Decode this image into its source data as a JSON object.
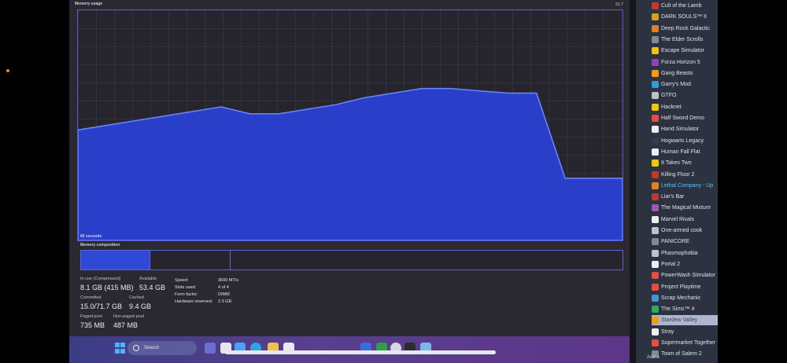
{
  "memory": {
    "title": "Memory usage",
    "max_label": "61.7",
    "seconds_label": "60 seconds",
    "composition_title": "Memory composition",
    "usage_curve": [
      0.48,
      0.5,
      0.52,
      0.54,
      0.56,
      0.58,
      0.55,
      0.55,
      0.57,
      0.59,
      0.62,
      0.64,
      0.66,
      0.66,
      0.65,
      0.64,
      0.64,
      0.27,
      0.27,
      0.27
    ],
    "stats": {
      "in_use_label": "In use (Compressed)",
      "in_use_value": "8.1 GB (415 MB)",
      "available_label": "Available",
      "available_value": "53.4 GB",
      "committed_label": "Committed",
      "committed_value": "15.0/71.7 GB",
      "cached_label": "Cached",
      "cached_value": "9.4 GB",
      "paged_label": "Paged pool",
      "paged_value": "735 MB",
      "nonpaged_label": "Non-paged pool",
      "nonpaged_value": "487 MB",
      "speed_label": "Speed:",
      "speed_value": "3600 MT/s",
      "slots_label": "Slots used:",
      "slots_value": "4 of 4",
      "form_label": "Form factor:",
      "form_value": "DIMM",
      "hw_label": "Hardware reserved:",
      "hw_value": "2.3 GB"
    }
  },
  "taskbar": {
    "search_placeholder": "Search"
  },
  "steam": {
    "games": [
      {
        "label": "Cult of the Lamb",
        "icon": "game-icon",
        "color": "#c0392b"
      },
      {
        "label": "DARK SOULS™ II",
        "icon": "game-icon",
        "color": "#d4a017"
      },
      {
        "label": "Deep Rock Galactic",
        "icon": "game-icon",
        "color": "#e67e22"
      },
      {
        "label": "The Elder Scrolls",
        "icon": "game-icon",
        "color": "#7f8c8d"
      },
      {
        "label": "Escape Simulator",
        "icon": "game-icon",
        "color": "#f1c40f"
      },
      {
        "label": "Forza Horizon 5",
        "icon": "game-icon",
        "color": "#8e44ad"
      },
      {
        "label": "Gang Beasts",
        "icon": "game-icon",
        "color": "#f39c12"
      },
      {
        "label": "Garry's Mod",
        "icon": "game-icon",
        "color": "#3498db"
      },
      {
        "label": "GTFO",
        "icon": "game-icon",
        "color": "#bdc3c7"
      },
      {
        "label": "Hacknet",
        "icon": "game-icon",
        "color": "#f1c40f"
      },
      {
        "label": "Half Sword Demo",
        "icon": "game-icon",
        "color": "#e74c3c"
      },
      {
        "label": "Hand Simulator",
        "icon": "game-icon",
        "color": "#ecf0f1"
      },
      {
        "label": "Hogwarts Legacy",
        "icon": "game-icon",
        "color": "#2c3e50"
      },
      {
        "label": "Human Fall Flat",
        "icon": "game-icon",
        "color": "#ecf0f1"
      },
      {
        "label": "It Takes Two",
        "icon": "game-icon",
        "color": "#f1c40f"
      },
      {
        "label": "Killing Floor 2",
        "icon": "game-icon",
        "color": "#c0392b"
      },
      {
        "label": "Lethal Company - Up",
        "icon": "game-icon",
        "color": "#e67e22"
      },
      {
        "label": "Liar's Bar",
        "icon": "game-icon",
        "color": "#c0392b"
      },
      {
        "label": "The Magical Mixture",
        "icon": "game-icon",
        "color": "#9b59b6"
      },
      {
        "label": "Marvel Rivals",
        "icon": "game-icon",
        "color": "#ecf0f1"
      },
      {
        "label": "One-armed cook",
        "icon": "game-icon",
        "color": "#bdc3c7"
      },
      {
        "label": "PANICORE",
        "icon": "game-icon",
        "color": "#7f8c8d"
      },
      {
        "label": "Phasmophobia",
        "icon": "game-icon",
        "color": "#bdc3c7"
      },
      {
        "label": "Portal 2",
        "icon": "game-icon",
        "color": "#ecf0f1"
      },
      {
        "label": "PowerWash Simulator",
        "icon": "game-icon",
        "color": "#e74c3c"
      },
      {
        "label": "Project Playtime",
        "icon": "game-icon",
        "color": "#e74c3c"
      },
      {
        "label": "Scrap Mechanic",
        "icon": "game-icon",
        "color": "#3498db"
      },
      {
        "label": "The Sims™ 4",
        "icon": "game-icon",
        "color": "#27ae60"
      },
      {
        "label": "Stardew Valley",
        "icon": "game-icon",
        "color": "#f39c12"
      },
      {
        "label": "Stray",
        "icon": "game-icon",
        "color": "#ecf0f1"
      },
      {
        "label": "Supermarket Together",
        "icon": "game-icon",
        "color": "#e74c3c"
      },
      {
        "label": "Town of Salem 2",
        "icon": "game-icon",
        "color": "#7f8c8d"
      }
    ],
    "selected_index": 28,
    "highlight_index": 16,
    "add_game_label": "Add a"
  }
}
